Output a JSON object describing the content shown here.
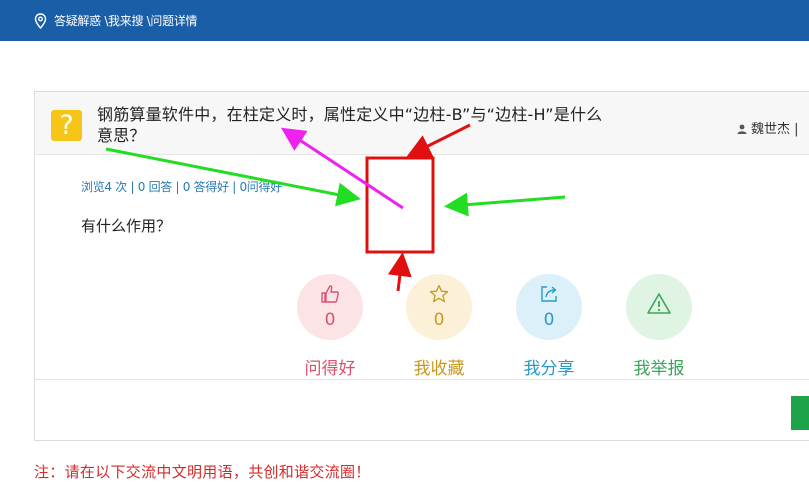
{
  "topbar": {
    "breadcrumb": "答疑解惑 \\我来搜 \\问题详情",
    "icon": "location-pin-icon"
  },
  "question": {
    "title": "钢筋算量软件中，在柱定义时，属性定义中“边柱-B”与“边柱-H”是什么意思？",
    "author": "魏世杰 | ",
    "stats": "浏览4 次 | 0 回答 | 0 答得好 | 0问得好",
    "description": "有什么作用？"
  },
  "actions": [
    {
      "label": "问得好",
      "count": "0",
      "icon": "thumbs-up-icon",
      "color": "#d9536f",
      "bg": "#fce3e6"
    },
    {
      "label": "我收藏",
      "count": "0",
      "icon": "star-icon",
      "color": "#c79a1e",
      "bg": "#fdf0d9"
    },
    {
      "label": "我分享",
      "count": "0",
      "icon": "share-icon",
      "color": "#2a9bc6",
      "bg": "#dcf0fa"
    },
    {
      "label": "我举报",
      "count": "",
      "icon": "warning-icon",
      "color": "#3aa65a",
      "bg": "#dff4e3"
    }
  ],
  "notice": "注：请在以下交流中文明用语，共创和谐交流圈！",
  "colors": {
    "topbar": "#1a5ea8",
    "annotation_red": "#e01010",
    "annotation_green": "#22dd22",
    "annotation_magenta": "#ee22ee"
  }
}
